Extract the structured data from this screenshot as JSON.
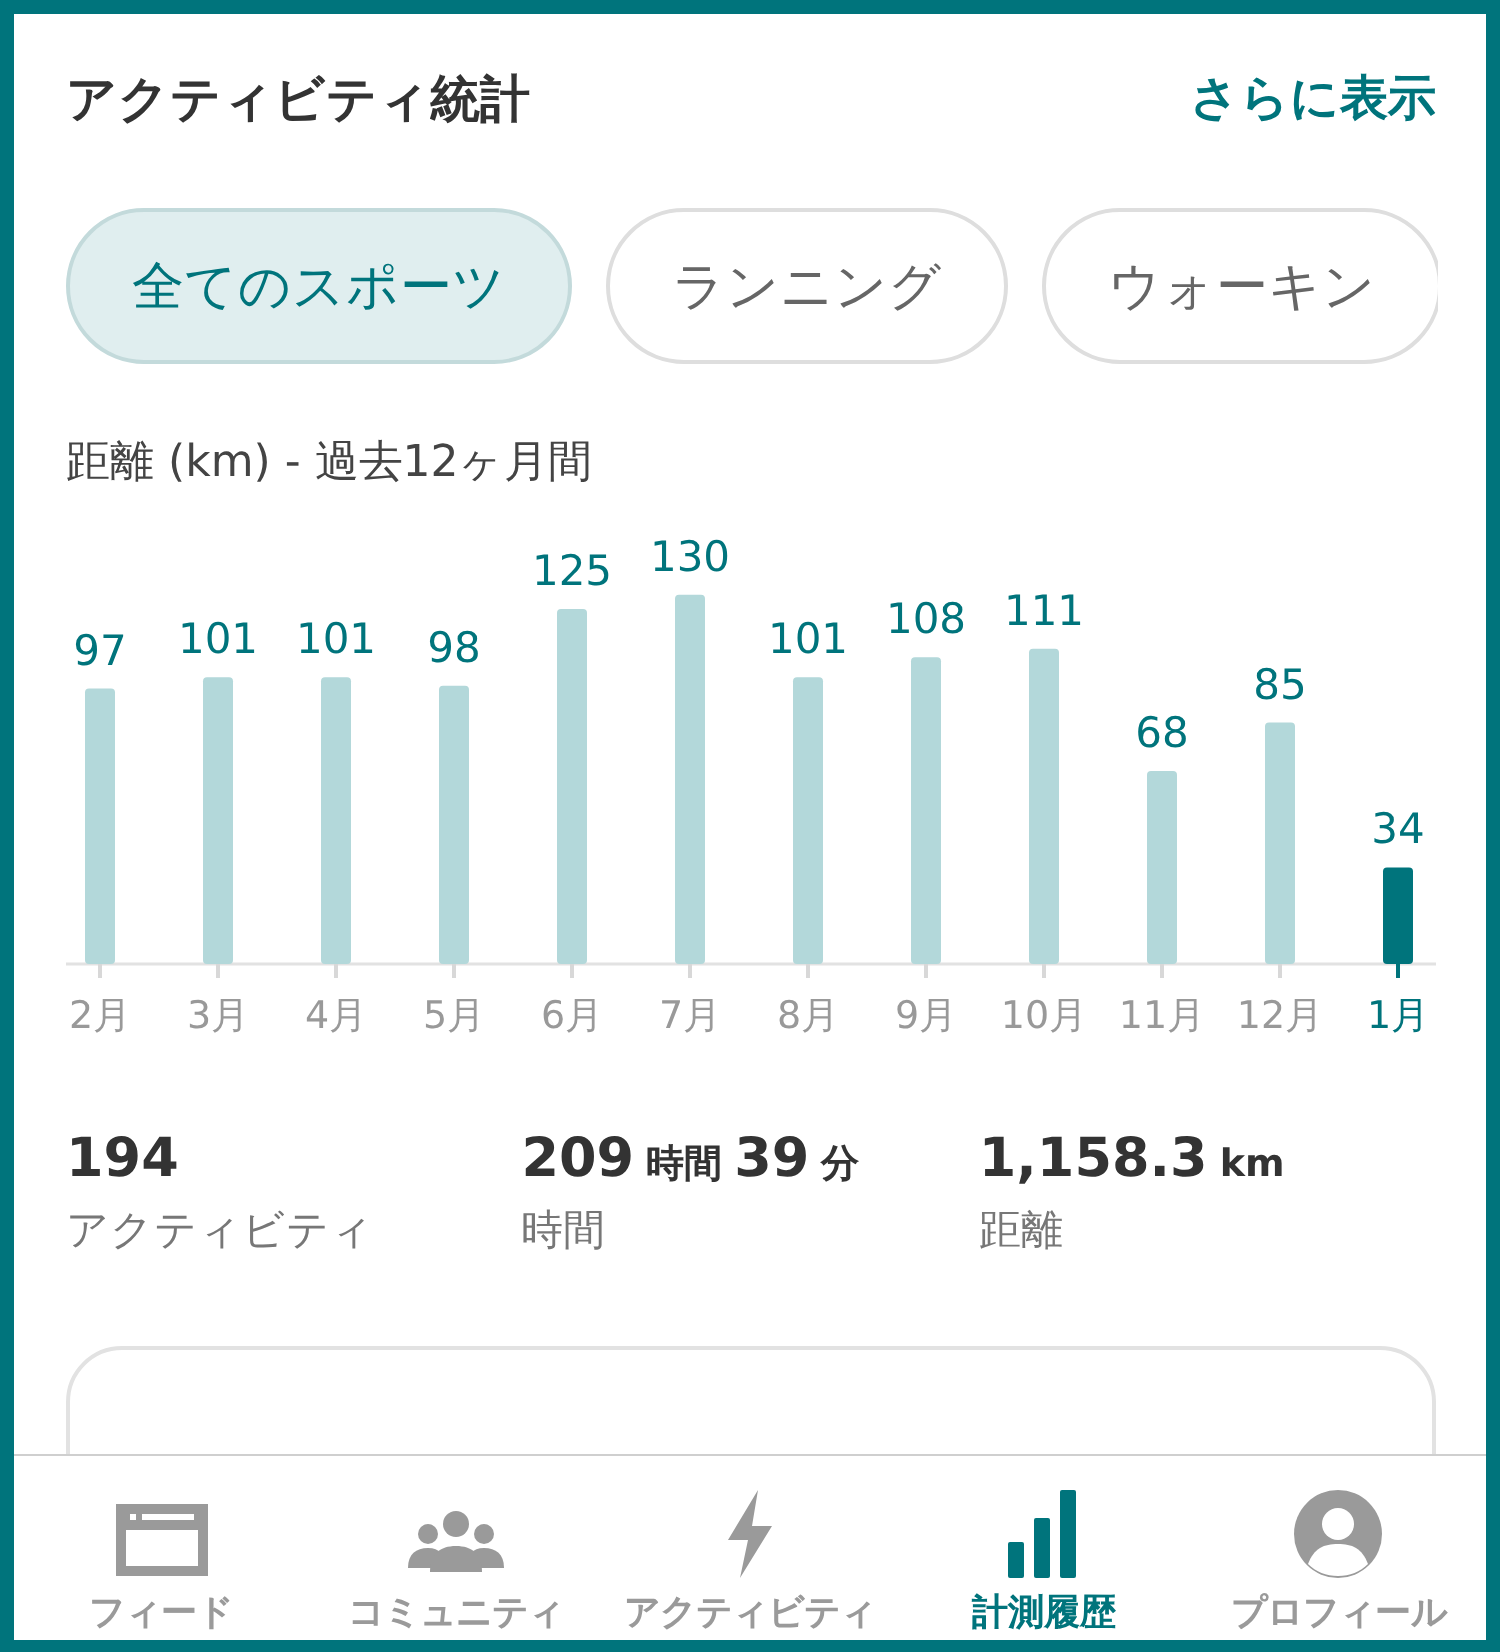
{
  "header": {
    "title": "アクティビティ統計",
    "more_link": "さらに表示"
  },
  "chips": [
    {
      "label": "全てのスポーツ",
      "selected": true
    },
    {
      "label": "ランニング",
      "selected": false
    },
    {
      "label": "ウォーキン",
      "selected": false
    }
  ],
  "chart_subtitle": "距離 (km) - 過去12ヶ月間",
  "chart_data": {
    "type": "bar",
    "categories": [
      "2月",
      "3月",
      "4月",
      "5月",
      "6月",
      "7月",
      "8月",
      "9月",
      "10月",
      "11月",
      "12月",
      "1月"
    ],
    "series": [
      {
        "color": "#b3d8da",
        "values": [
          97,
          101,
          101,
          98,
          125,
          130,
          101,
          108,
          111,
          68,
          85,
          null
        ]
      },
      {
        "color": "#00747c",
        "values": [
          null,
          null,
          null,
          null,
          null,
          null,
          null,
          null,
          null,
          null,
          null,
          34
        ]
      }
    ],
    "data_labels": true
  },
  "stats": [
    {
      "parts": [
        {
          "kind": "num",
          "text": "194"
        }
      ],
      "label": "アクティビティ"
    },
    {
      "parts": [
        {
          "kind": "num",
          "text": "209"
        },
        {
          "kind": "unit",
          "text": "時間"
        },
        {
          "kind": "num",
          "text": "39"
        },
        {
          "kind": "unit",
          "text": "分"
        }
      ],
      "label": "時間"
    },
    {
      "parts": [
        {
          "kind": "num",
          "text": "1,158.3"
        },
        {
          "kind": "unit",
          "text": "km"
        }
      ],
      "label": "距離"
    }
  ],
  "nav": [
    {
      "kind": "feed",
      "label": "フィード",
      "selected": false
    },
    {
      "kind": "community",
      "label": "コミュニティ",
      "selected": false
    },
    {
      "kind": "activity",
      "label": "アクティビティ",
      "selected": false
    },
    {
      "kind": "history",
      "label": "計測履歴",
      "selected": true
    },
    {
      "kind": "profile",
      "label": "プロフィール",
      "selected": false
    }
  ]
}
